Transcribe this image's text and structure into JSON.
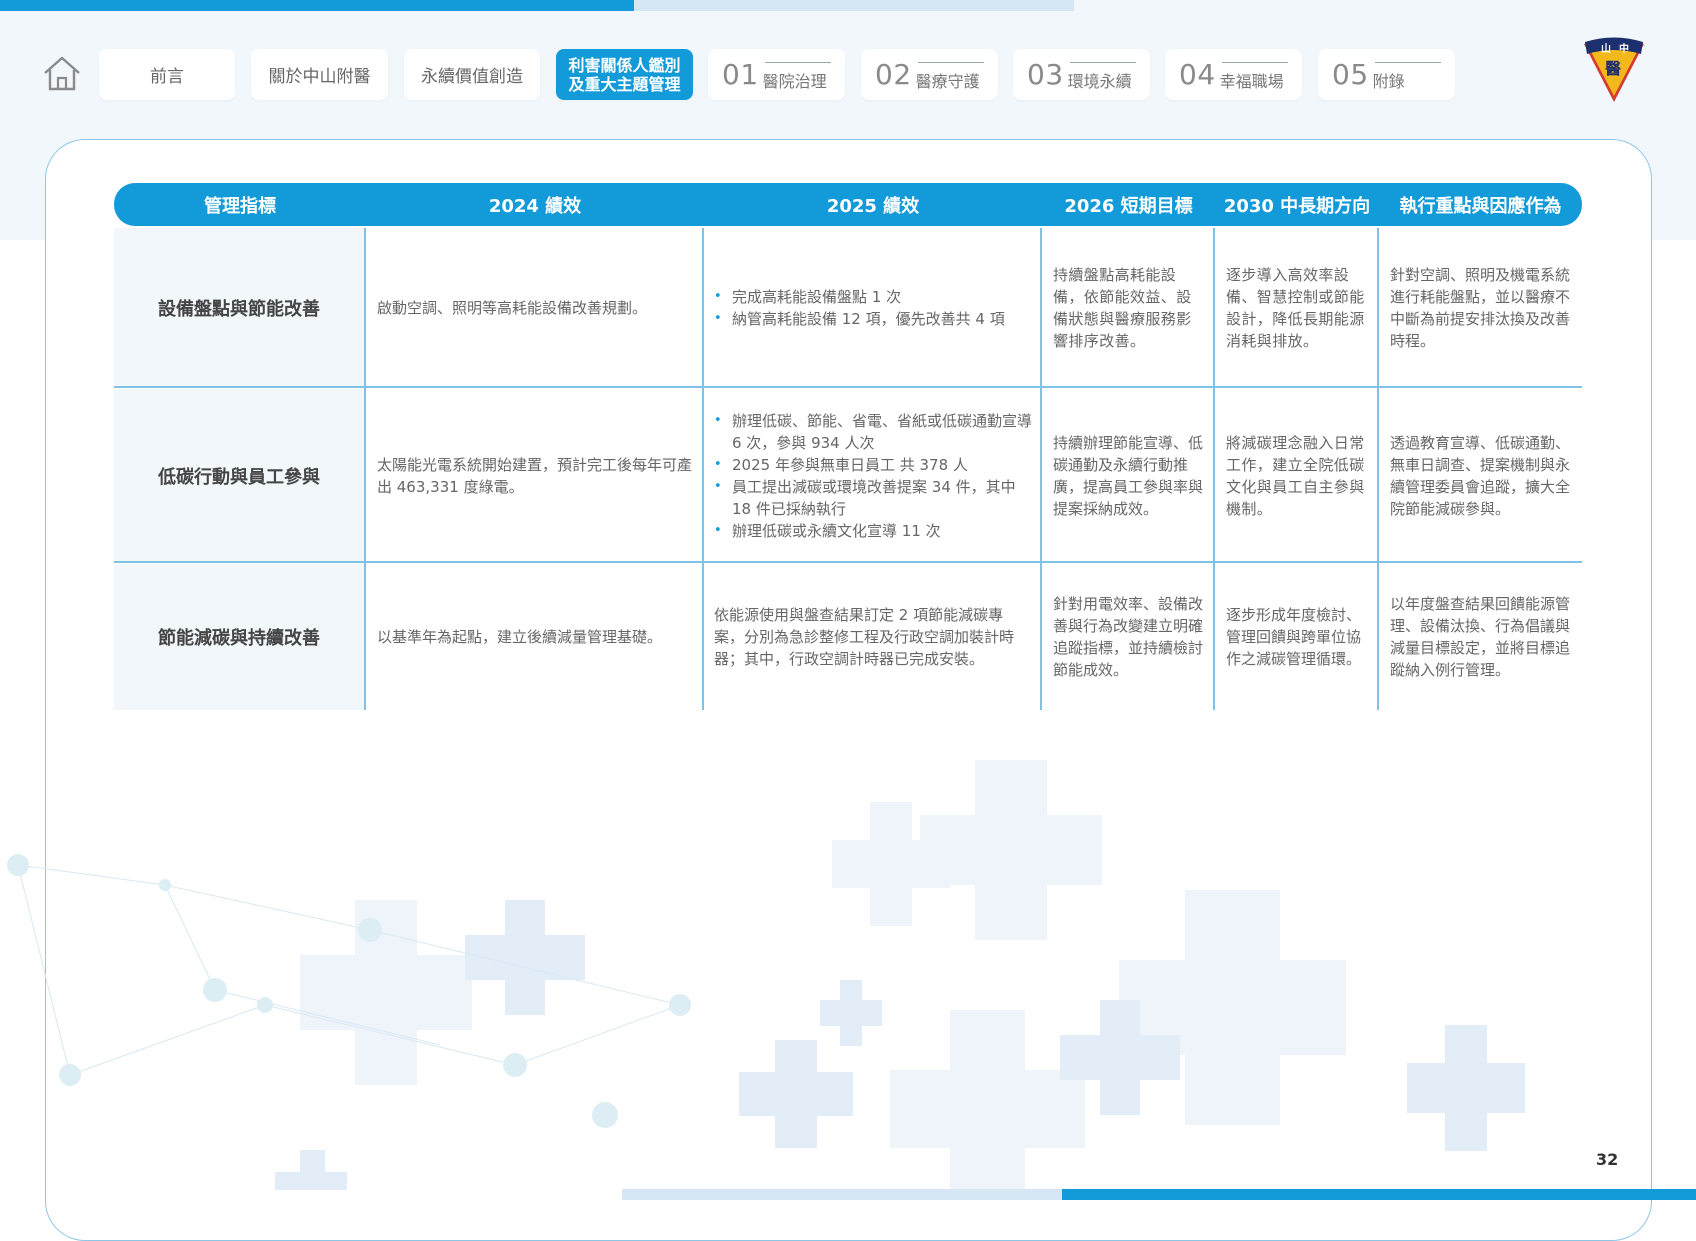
{
  "nav": {
    "items": [
      "前言",
      "關於中山附醫",
      "永續價值創造"
    ],
    "active": "利害關係人鑑別\n及重大主題管理",
    "chapters": [
      {
        "num": "01",
        "label": "醫院治理"
      },
      {
        "num": "02",
        "label": "醫療守護"
      },
      {
        "num": "03",
        "label": "環境永續"
      },
      {
        "num": "04",
        "label": "幸福職場"
      },
      {
        "num": "05",
        "label": "附錄"
      }
    ]
  },
  "logo": {
    "text_top_left": "山",
    "text_top_right": "中",
    "text_center": "醫"
  },
  "table": {
    "headers": [
      "管理指標",
      "2024 績效",
      "2025 績效",
      "2026 短期目標",
      "2030 中長期方向",
      "執行重點與因應作為"
    ],
    "rows": [
      {
        "label": "設備盤點與節能改善",
        "c2024": "啟動空調、照明等高耗能設備改善規劃。",
        "c2025": [
          "完成高耗能設備盤點 1 次",
          "納管高耗能設備 12 項，優先改善共 4 項"
        ],
        "c2026": "持續盤點高耗能設備，依節能效益、設備狀態與醫療服務影響排序改善。",
        "c2030": "逐步導入高效率設備、智慧控制或節能設計，降低長期能源消耗與排放。",
        "action": "針對空調、照明及機電系統進行耗能盤點，並以醫療不中斷為前提安排汰換及改善時程。"
      },
      {
        "label": "低碳行動與員工參與",
        "c2024": "太陽能光電系統開始建置，預計完工後每年可產出 463,331 度綠電。",
        "c2025": [
          "辦理低碳、節能、省電、省紙或低碳通勤宣導 6 次，參與 934 人次",
          "2025 年參與無車日員工 共 378 人",
          "員工提出減碳或環境改善提案 34 件，其中 18 件已採納執行",
          "辦理低碳或永續文化宣導 11 次"
        ],
        "c2026": "持續辦理節能宣導、低碳通勤及永續行動推廣，提高員工參與率與提案採納成效。",
        "c2030": "將減碳理念融入日常工作，建立全院低碳文化與員工自主參與機制。",
        "action": "透過教育宣導、低碳通勤、無車日調查、提案機制與永續管理委員會追蹤，擴大全院節能減碳參與。"
      },
      {
        "label": "節能減碳與持續改善",
        "c2024": "以基準年為起點，建立後續減量管理基礎。",
        "c2025": "依能源使用與盤查結果訂定 2 項節能減碳專案，分別為急診整修工程及行政空調加裝計時器；其中，行政空調計時器已完成安裝。",
        "c2026": "針對用電效率、設備改善與行為改變建立明確追蹤指標，並持續檢討節能成效。",
        "c2030": "逐步形成年度檢討、管理回饋與跨單位協作之減碳管理循環。",
        "action": "以年度盤查結果回饋能源管理、設備汰換、行為倡議與減量目標設定，並將目標追蹤納入例行管理。"
      }
    ]
  },
  "page_number": "32",
  "colors": {
    "accent": "#139ad8",
    "light": "#d6e6f5",
    "bg": "#f2f7fc"
  }
}
